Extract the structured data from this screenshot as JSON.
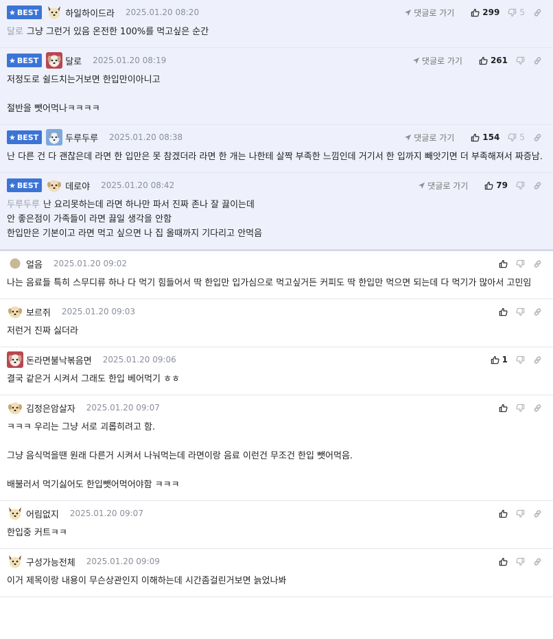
{
  "best_label": "BEST",
  "goto_label": "댓글로 가기",
  "comments": [
    {
      "best": true,
      "avatar": "dog-yellow",
      "nick": "하일하이드라",
      "date": "2025.01.20 08:20",
      "mention": "달로",
      "text": "그냥 그런거 있음 온전한 100%를 먹고싶은 순간",
      "up": "299",
      "down": "5"
    },
    {
      "best": true,
      "avatar": "dog-red",
      "nick": "달로",
      "date": "2025.01.20 08:19",
      "mention": "",
      "text": "저정도로 쉴드치는거보면 한입만이아니고\n\n절반을 뺏어먹나ㅋㅋㅋㅋ",
      "up": "261",
      "down": ""
    },
    {
      "best": true,
      "avatar": "dog-blue",
      "nick": "두루두루",
      "date": "2025.01.20 08:38",
      "mention": "",
      "text": "난 다른 건 다 괜찮은데 라면 한 입만은 못 참겠더라 라면 한 개는 나한테 살짝 부족한 느낌인데 거기서 한 입까지 빼앗기면 더 부족해져서 짜증남.",
      "up": "154",
      "down": "5"
    },
    {
      "best": true,
      "avatar": "dog-cream",
      "nick": "데로야",
      "date": "2025.01.20 08:42",
      "mention": "두루두루",
      "text": "난 요리못하는데 라면 하나만 파서 진짜 존나 잘 끓이는데\n안 좋은점이 가족들이 라면 끓일 생각을 안함\n한입만은 기본이고 라면 먹고 싶으면 나 집 올때까지 기다리고 안먹음",
      "up": "79",
      "down": ""
    },
    {
      "best": false,
      "avatar": "circle-tan",
      "nick": "얼음",
      "date": "2025.01.20 09:02",
      "mention": "",
      "text": "나는 음료들 특히 스무디류 하나 다 먹기 힘들어서 딱 한입만 입가심으로 먹고싶거든 커피도 딱 한입만 먹으면 되는데 다 먹기가 많아서 고민임",
      "up": "",
      "down": ""
    },
    {
      "best": false,
      "avatar": "dog-cream",
      "nick": "보르쥐",
      "date": "2025.01.20 09:03",
      "mention": "",
      "text": "저런거 진짜 싫더라",
      "up": "",
      "down": ""
    },
    {
      "best": false,
      "avatar": "dog-red",
      "nick": "돈라면불낙볶음면",
      "date": "2025.01.20 09:06",
      "mention": "",
      "text": "결국 같은거 시켜서 그래도 한입 베어먹기 ㅎㅎ",
      "up": "1",
      "down": ""
    },
    {
      "best": false,
      "avatar": "dog-cream",
      "nick": "김정은암살자",
      "date": "2025.01.20 09:07",
      "mention": "",
      "text": "ㅋㅋㅋ 우리는 그냥 서로 괴롭히려고 함.\n\n그냥 음식먹을땐 원래 다른거 시켜서 나눠먹는데 라면이랑 음료 이런건 무조건 한입 뺏어먹음.\n\n배불러서 먹기싫어도 한입뺏어먹어야함 ㅋㅋㅋ",
      "up": "",
      "down": ""
    },
    {
      "best": false,
      "avatar": "dog-yellow",
      "nick": "어림없지",
      "date": "2025.01.20 09:07",
      "mention": "",
      "text": "한입중 커트ㅋㅋ",
      "up": "",
      "down": ""
    },
    {
      "best": false,
      "avatar": "dog-yellow",
      "nick": "구성가능전체",
      "date": "2025.01.20 09:09",
      "mention": "",
      "text": "이거 제목이랑 내용이 무슨상관인지 이해하는데 시간좀걸린거보면 늙었나봐",
      "up": "",
      "down": ""
    }
  ],
  "colors": {
    "best_bg": "#eef1fb",
    "badge": "#3b74d6",
    "date": "#8a8f99",
    "mention": "#9aa0aa"
  }
}
